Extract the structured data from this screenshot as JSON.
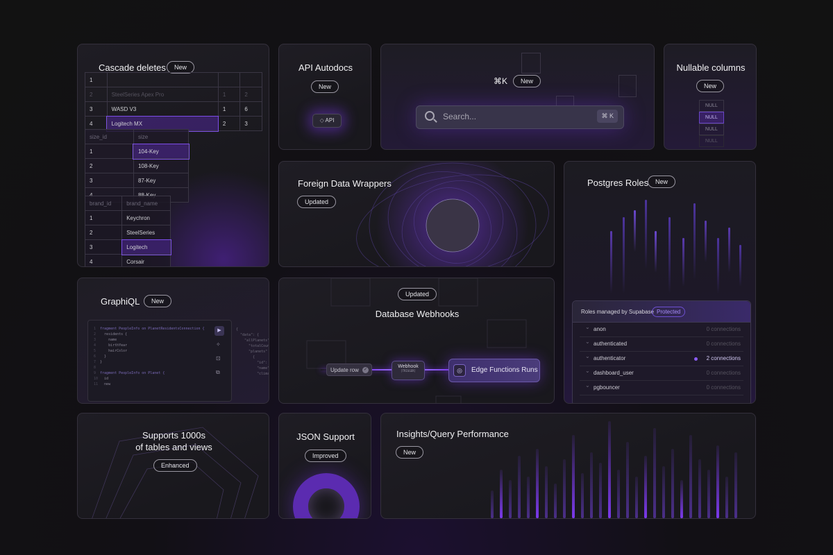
{
  "colors": {
    "accent": "#7c3aed",
    "card_bg": "#1c1b21",
    "border": "#34303c"
  },
  "cascade": {
    "title": "Cascade deletes",
    "badge": "New",
    "t1": [
      [
        "1",
        "",
        "",
        ""
      ],
      [
        "2",
        "SteelSeries Apex Pro",
        "1",
        "2"
      ],
      [
        "3",
        "WASD V3",
        "1",
        "6"
      ],
      [
        "4",
        "Logitech MX",
        "2",
        "3"
      ]
    ],
    "t2_header": [
      "size_id",
      "size"
    ],
    "t2": [
      [
        "1",
        "104-Key"
      ],
      [
        "2",
        "108-Key"
      ],
      [
        "3",
        "87-Key"
      ],
      [
        "4",
        "88-Key"
      ]
    ],
    "t3_header": [
      "brand_id",
      "brand_name"
    ],
    "t3": [
      [
        "1",
        "Keychron"
      ],
      [
        "2",
        "SteelSeries"
      ],
      [
        "3",
        "Logitech"
      ],
      [
        "4",
        "Corsair"
      ]
    ]
  },
  "api_autodocs": {
    "title": "API Autodocs",
    "badge": "New",
    "chip": "API"
  },
  "command": {
    "shortcut": "⌘K",
    "badge": "New",
    "search_placeholder": "Search...",
    "search_shortcut": "⌘ K"
  },
  "nullable": {
    "title": "Nullable columns",
    "badge": "New",
    "cells": [
      "NULL",
      "NULL",
      "NULL",
      "NULL"
    ]
  },
  "fdw": {
    "title": "Foreign Data Wrappers",
    "badge": "Updated"
  },
  "roles": {
    "title": "Postgres Roles",
    "badge": "New",
    "panel_title": "Roles managed by Supabase",
    "panel_badge": "Protected",
    "items": [
      {
        "name": "anon",
        "connections": "0 connections"
      },
      {
        "name": "authenticated",
        "connections": "0 connections"
      },
      {
        "name": "authenticator",
        "connections": "2 connections"
      },
      {
        "name": "dashboard_user",
        "connections": "0 connections"
      },
      {
        "name": "pgbouncer",
        "connections": "0 connections"
      }
    ]
  },
  "graphiql": {
    "title": "GraphiQL",
    "badge": "New",
    "code_lines": [
      "fragment PeopleInfo on PlanetResidentsConnection {",
      "  residents {",
      "    name",
      "    birthYear",
      "    hairColor",
      "  }",
      "}",
      "",
      "fragment PeopleInfo on Planet {",
      "  id",
      "  new"
    ],
    "result_lines": [
      "{",
      "  \"data\": {",
      "    \"allPlanets\": {",
      "      \"totalCount\"",
      "      \"planets\"",
      "        {",
      "          \"id\":",
      "          \"name\"",
      "          \"climate\""
    ]
  },
  "webhooks": {
    "badge": "Updated",
    "title": "Database Webhooks",
    "update_row": "Update row",
    "webhook": "Webhook",
    "trigger": "[TRIGGER]",
    "edge": "Edge Functions Runs"
  },
  "supports": {
    "title_line1": "Supports 1000s",
    "title_line2": "of tables and views",
    "badge": "Enhanced"
  },
  "json": {
    "title": "JSON Support",
    "badge": "Improved"
  },
  "insights": {
    "title": "Insights/Query Performance",
    "badge": "New"
  }
}
